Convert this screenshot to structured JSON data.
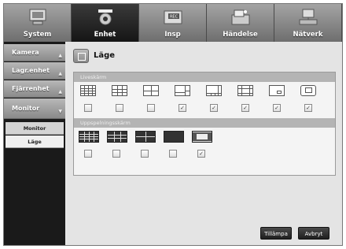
{
  "nav": {
    "tabs": [
      {
        "label": "System",
        "icon": "system-icon"
      },
      {
        "label": "Enhet",
        "icon": "camera-icon"
      },
      {
        "label": "Insp",
        "icon": "record-icon"
      },
      {
        "label": "Händelse",
        "icon": "event-icon"
      },
      {
        "label": "Nätverk",
        "icon": "network-icon"
      }
    ],
    "active_tab": "Enhet"
  },
  "sidebar": {
    "items": [
      {
        "label": "Kamera"
      },
      {
        "label": "Lagr.enhet"
      },
      {
        "label": "Fjärrenhet"
      },
      {
        "label": "Monitor"
      }
    ],
    "subitems": [
      {
        "label": "Monitor"
      },
      {
        "label": "Läge"
      }
    ],
    "active_subitem": "Läge"
  },
  "page": {
    "title": "Läge",
    "icon": "mode-icon"
  },
  "live": {
    "section_label": "Liveskärm",
    "layouts": [
      {
        "name": "split-16",
        "checked": false
      },
      {
        "name": "split-9",
        "checked": false
      },
      {
        "name": "split-4",
        "checked": false
      },
      {
        "name": "split-6",
        "checked": true
      },
      {
        "name": "split-8",
        "checked": true
      },
      {
        "name": "split-13",
        "checked": true
      },
      {
        "name": "single",
        "checked": true
      },
      {
        "name": "pip",
        "checked": true
      }
    ]
  },
  "sequence": {
    "section_label": "Uppspelningsskärm",
    "layouts": [
      {
        "name": "split-16",
        "checked": false
      },
      {
        "name": "split-9",
        "checked": false
      },
      {
        "name": "split-4",
        "checked": false
      },
      {
        "name": "single",
        "checked": false
      },
      {
        "name": "split-6",
        "checked": true
      }
    ]
  },
  "buttons": {
    "apply": "Tillämpa",
    "cancel": "Avbryt"
  },
  "colors": {
    "active_tab": "#1c1c1c",
    "sidebar": "#1a1a1a",
    "panel": "#f4f4f4"
  }
}
